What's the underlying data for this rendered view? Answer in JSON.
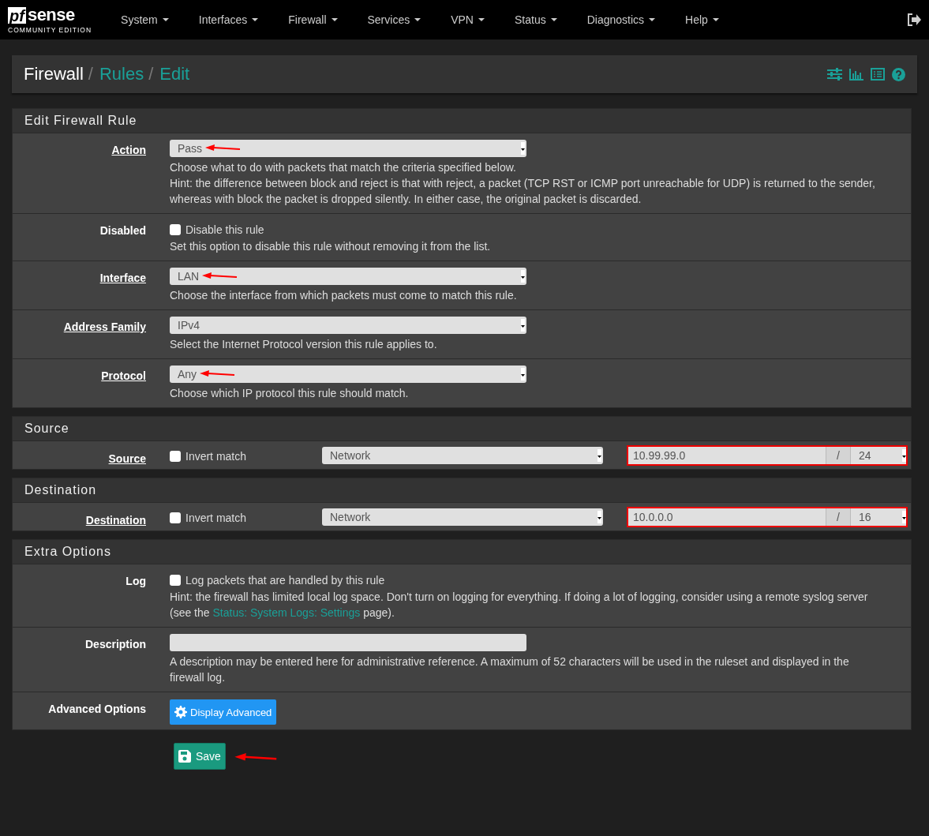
{
  "navbar": {
    "logo": {
      "prefix": "pf",
      "name": "sense",
      "edition": "COMMUNITY EDITION"
    },
    "menu": [
      {
        "label": "System"
      },
      {
        "label": "Interfaces"
      },
      {
        "label": "Firewall"
      },
      {
        "label": "Services"
      },
      {
        "label": "VPN"
      },
      {
        "label": "Status"
      },
      {
        "label": "Diagnostics"
      },
      {
        "label": "Help"
      }
    ]
  },
  "breadcrumb": [
    {
      "label": "Firewall",
      "link": false
    },
    {
      "separator": "/",
      "label": "Rules",
      "link": true
    },
    {
      "separator": "/",
      "label": "Edit",
      "link": true
    }
  ],
  "sections": [
    {
      "title": "Edit Firewall Rule",
      "rows": [
        {
          "kind": "select",
          "label": "Action",
          "label_link": true,
          "value": "Pass",
          "annotated": true,
          "help": [
            "Choose what to do with packets that match the criteria specified below.",
            "Hint: the difference between block and reject is that with reject, a packet (TCP RST or ICMP port unreachable for UDP) is returned to the sender, whereas with block the packet is dropped silently. In either case, the original packet is discarded."
          ]
        },
        {
          "kind": "checkbox",
          "label": "Disabled",
          "label_link": false,
          "text": "Disable this rule",
          "checked": false,
          "help": [
            "Set this option to disable this rule without removing it from the list."
          ]
        },
        {
          "kind": "select",
          "label": "Interface",
          "label_link": true,
          "value": "LAN",
          "annotated": true,
          "help": [
            "Choose the interface from which packets must come to match this rule."
          ]
        },
        {
          "kind": "select",
          "label": "Address Family",
          "label_link": true,
          "value": "IPv4",
          "annotated": false,
          "help": [
            "Select the Internet Protocol version this rule applies to."
          ]
        },
        {
          "kind": "select",
          "label": "Protocol",
          "label_link": true,
          "value": "Any",
          "annotated": true,
          "help": [
            "Choose which IP protocol this rule should match."
          ]
        }
      ]
    },
    {
      "title": "Source",
      "rows": [
        {
          "kind": "address",
          "label": "Source",
          "label_link": true,
          "invert_text": "Invert match",
          "invert_checked": false,
          "type": "Network",
          "address": "10.99.99.0",
          "separator": "/",
          "mask": "24",
          "invalid": true
        }
      ]
    },
    {
      "title": "Destination",
      "rows": [
        {
          "kind": "address",
          "label": "Destination",
          "label_link": true,
          "invert_text": "Invert match",
          "invert_checked": false,
          "type": "Network",
          "address": "10.0.0.0",
          "separator": "/",
          "mask": "16",
          "invalid": true
        }
      ]
    },
    {
      "title": "Extra Options",
      "rows": [
        {
          "kind": "checkbox",
          "label": "Log",
          "label_link": false,
          "text": "Log packets that are handled by this rule",
          "checked": false,
          "help": [
            "Hint: the firewall has limited local log space. Don't turn on logging for everything. If doing a lot of logging, consider using a remote syslog server (see the "
          ],
          "help_link": "Status: System Logs: Settings",
          "help_after": " page)."
        },
        {
          "kind": "text",
          "label": "Description",
          "label_link": false,
          "value": "",
          "help": [
            "A description may be entered here for administrative reference. A maximum of 52 characters will be used in the ruleset and displayed in the firewall log."
          ]
        },
        {
          "kind": "button",
          "label": "Advanced Options",
          "label_link": false,
          "button": "Display Advanced"
        }
      ]
    }
  ],
  "save": {
    "label": "Save",
    "annotated": true
  }
}
